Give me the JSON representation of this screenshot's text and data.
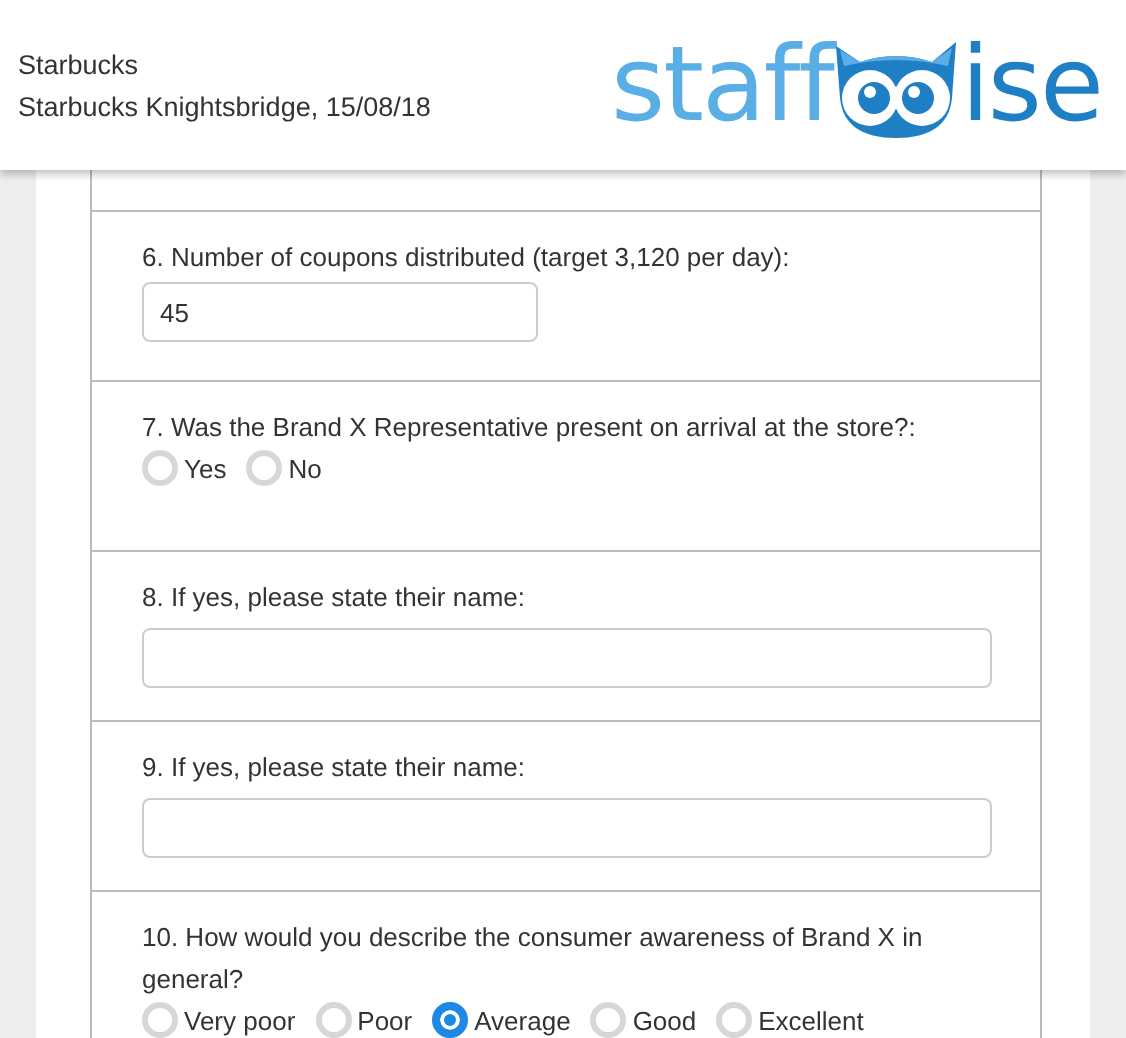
{
  "header": {
    "client": "Starbucks",
    "visit": "Starbucks Knightsbridge, 15/08/18",
    "logo": {
      "left": "staff",
      "right": "ise"
    }
  },
  "questions": [
    {
      "kind": "text",
      "label": "6. Number of coupons distributed (target 3,120 per day):",
      "value": "45",
      "wide": false
    },
    {
      "kind": "radio",
      "label": "7. Was the Brand X Representative present on arrival at the store?:",
      "options": [
        {
          "label": "Yes",
          "selected": false
        },
        {
          "label": "No",
          "selected": false
        }
      ]
    },
    {
      "kind": "text",
      "label": "8. If yes, please state their name:",
      "wide": true
    },
    {
      "kind": "text",
      "label": "9. If yes, please state their name:",
      "wide": true
    },
    {
      "kind": "radio",
      "label": "10. How would you describe the consumer awareness of Brand X in general?",
      "options": [
        {
          "label": "Very poor",
          "selected": false
        },
        {
          "label": "Poor",
          "selected": false
        },
        {
          "label": "Average",
          "selected": true
        },
        {
          "label": "Good",
          "selected": false
        },
        {
          "label": "Excellent",
          "selected": false
        }
      ]
    }
  ]
}
